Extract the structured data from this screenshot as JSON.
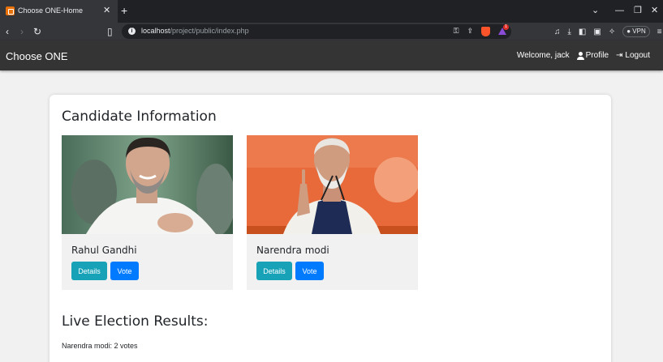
{
  "browser": {
    "tab_title": "Choose ONE-Home",
    "tab_close": "✕",
    "new_tab": "+",
    "url_host": "localhost",
    "url_path": "/project/public/index.php",
    "vpn_label": "VPN",
    "rewards_count": "1",
    "icons": [
      "back-icon",
      "forward-icon",
      "reload-icon",
      "bookmark-icon",
      "info-icon",
      "key-icon",
      "share-icon",
      "brave-shield-icon",
      "rewards-icon",
      "media-icon",
      "download-icon",
      "sidebar-icon",
      "wallet-icon",
      "leo-icon",
      "menu-icon"
    ]
  },
  "navbar": {
    "brand": "Choose ONE",
    "welcome": "Welcome, jack",
    "profile": "Profile",
    "logout": "Logout"
  },
  "main": {
    "title": "Candidate Information",
    "candidates": [
      {
        "name": "Rahul Gandhi",
        "details_label": "Details",
        "vote_label": "Vote"
      },
      {
        "name": "Narendra modi",
        "details_label": "Details",
        "vote_label": "Vote"
      }
    ],
    "results_title": "Live Election Results:",
    "results": [
      "Narendra modi: 2 votes"
    ]
  },
  "colors": {
    "navbar_bg": "#343434",
    "details_btn": "#17a2b8",
    "vote_btn": "#007bff",
    "page_bg": "#f1f1f1"
  }
}
